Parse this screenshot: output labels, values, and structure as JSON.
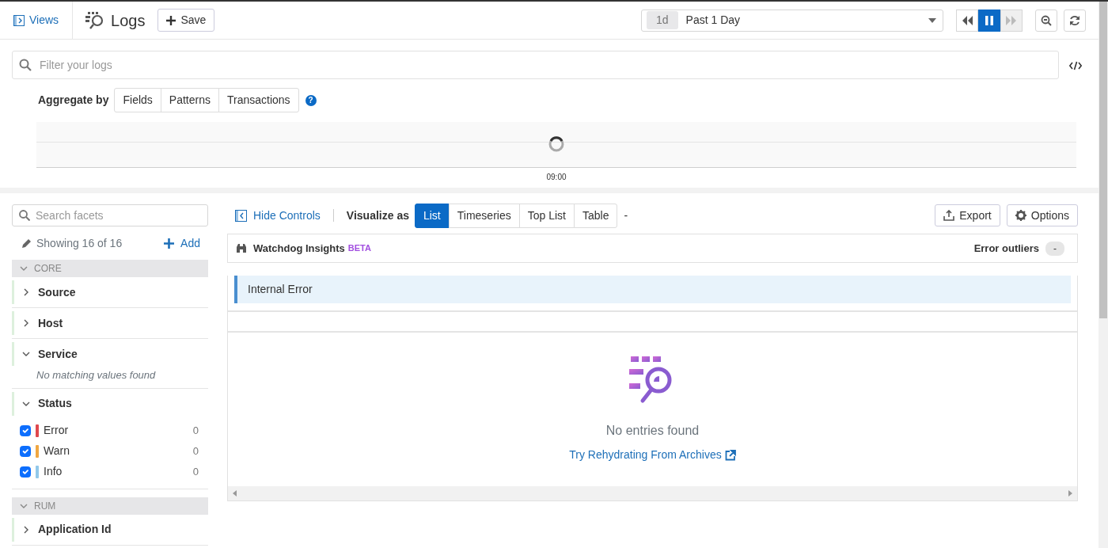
{
  "topbar": {
    "views_link": "Views",
    "title": "Logs",
    "save_button": "Save",
    "time_badge": "1d",
    "time_range": "Past 1 Day",
    "playback": [
      {
        "kind": "rewind",
        "selected": false,
        "disabled": false
      },
      {
        "kind": "pause",
        "selected": true,
        "disabled": false
      },
      {
        "kind": "forward",
        "selected": false,
        "disabled": true
      }
    ]
  },
  "search": {
    "placeholder": "Filter your logs"
  },
  "aggregate": {
    "label": "Aggregate by",
    "options": [
      {
        "label": "Fields",
        "selected": false
      },
      {
        "label": "Patterns",
        "selected": false
      },
      {
        "label": "Transactions",
        "selected": false
      }
    ],
    "help_glyph": "?"
  },
  "timeline": {
    "tick": "09:00",
    "loading": true
  },
  "facets": {
    "placeholder": "Search facets",
    "showing": "Showing 16 of 16",
    "add": "Add",
    "groups": [
      {
        "name": "CORE",
        "expanded": true,
        "facets": [
          {
            "name": "Source",
            "expanded": false
          },
          {
            "name": "Host",
            "expanded": false
          },
          {
            "name": "Service",
            "expanded": true,
            "empty_note": "No matching values found"
          },
          {
            "name": "Status",
            "expanded": true,
            "values": [
              {
                "label": "Error",
                "checked": true,
                "color": "#e0484e",
                "count": "0"
              },
              {
                "label": "Warn",
                "checked": true,
                "color": "#f0a742",
                "count": "0"
              },
              {
                "label": "Info",
                "checked": true,
                "color": "#92c9ea",
                "count": "0"
              }
            ]
          }
        ]
      },
      {
        "name": "RUM",
        "expanded": true,
        "facets": [
          {
            "name": "Application Id",
            "expanded": false
          }
        ]
      }
    ]
  },
  "toolbar": {
    "hide_controls": "Hide Controls",
    "visualize_label": "Visualize as",
    "visualizations": [
      {
        "label": "List",
        "selected": true
      },
      {
        "label": "Timeseries",
        "selected": false
      },
      {
        "label": "Top List",
        "selected": false
      },
      {
        "label": "Table",
        "selected": false
      }
    ],
    "trailing": "-",
    "export": "Export",
    "options": "Options"
  },
  "insights": {
    "title": "Watchdog Insights",
    "tag": "BETA",
    "outliers_label": "Error outliers",
    "outliers_count": "-",
    "items": [
      "Internal Error"
    ]
  },
  "results": {
    "empty_message": "No entries found",
    "link": "Try Rehydrating From Archives"
  }
}
